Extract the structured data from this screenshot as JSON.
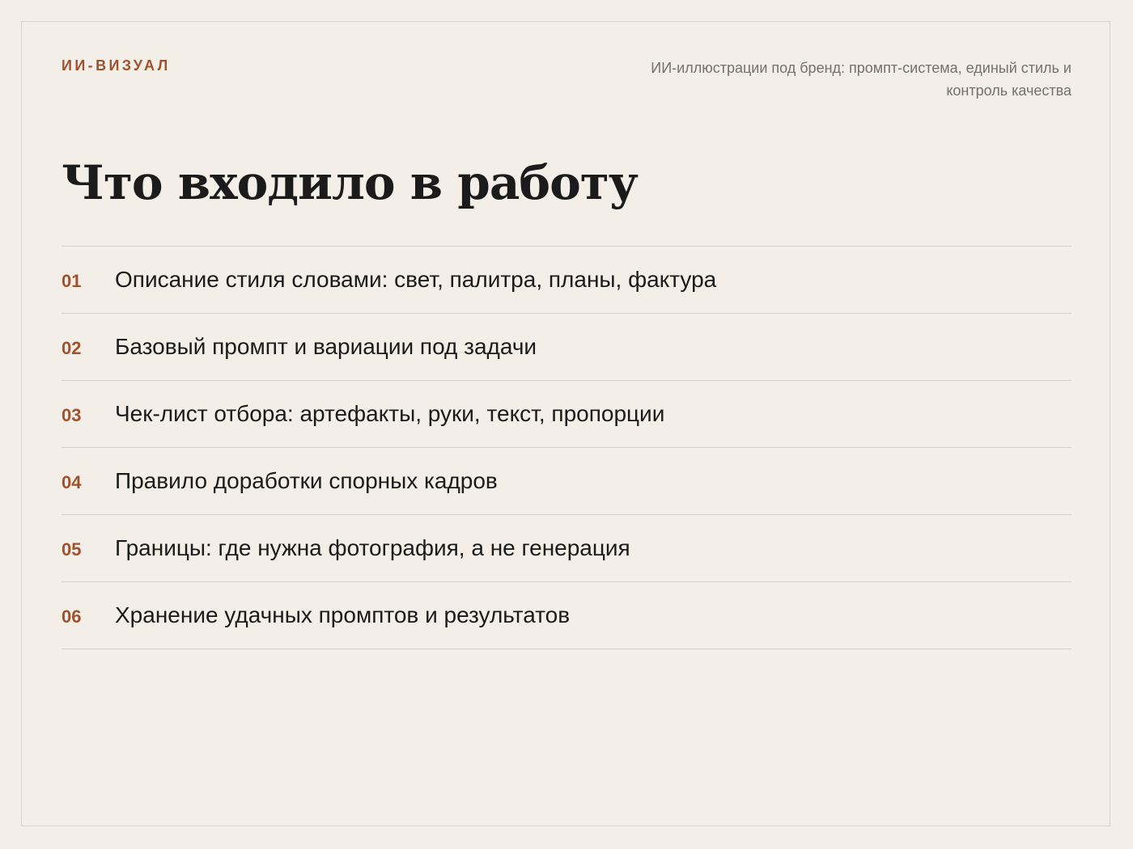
{
  "header": {
    "brand": "ИИ-ВИЗУАЛ",
    "subtitle": "ИИ-иллюстрации под бренд: промпт-система, единый стиль и контроль качества"
  },
  "main": {
    "title": "Что входило в работу",
    "items": [
      {
        "num": "01",
        "text": "Описание стиля словами: свет, палитра, планы, фактура"
      },
      {
        "num": "02",
        "text": "Базовый промпт и вариации под задачи"
      },
      {
        "num": "03",
        "text": "Чек-лист отбора: артефакты, руки, текст, пропорции"
      },
      {
        "num": "04",
        "text": "Правило доработки спорных кадров"
      },
      {
        "num": "05",
        "text": "Границы: где нужна фотография, а не генерация"
      },
      {
        "num": "06",
        "text": "Хранение удачных промптов и результатов"
      }
    ]
  },
  "colors": {
    "background": "#f3eee8",
    "accent": "#a0522d",
    "text": "#1b1b1b",
    "muted": "#77706a",
    "divider": "#d7d0c8"
  }
}
